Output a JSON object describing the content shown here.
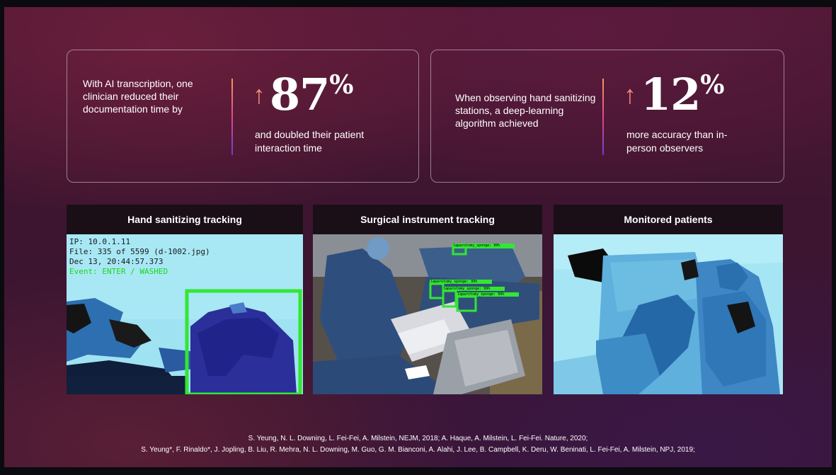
{
  "stats": [
    {
      "description": "With AI transcription, one clinician reduced their documentation time by",
      "value": "87",
      "unit": "%",
      "caption": "and doubled their patient interaction time",
      "arrow": "↑"
    },
    {
      "description": "When observing hand sanitizing stations, a deep-learning algorithm achieved",
      "value": "12",
      "unit": "%",
      "caption": "more accuracy than in-person observers",
      "arrow": "↑"
    }
  ],
  "panels": [
    {
      "title": "Hand sanitizing tracking",
      "overlay": {
        "ip": "IP: 10.0.1.11",
        "file": "File: 335 of 5599 (d-1002.jpg)",
        "date": "Dec 13, 20:44:57.373",
        "event": "Event: ENTER / WASHED"
      }
    },
    {
      "title": "Surgical instrument tracking",
      "labels": [
        "laparotomy_sponge: 99%",
        "laparotomy_sponge: 99%",
        "laparotomy_sponge: 99%",
        "laparotomy_sponge: 99%"
      ]
    },
    {
      "title": "Monitored patients"
    }
  ],
  "citations": {
    "line1": "S. Yeung, N. L. Downing, L. Fei-Fei, A. Milstein, NEJM, 2018; A. Haque, A. Milstein, L. Fei-Fei. Nature, 2020;",
    "line2": "S. Yeung*, F. Rinaldo*, J. Jopling, B. Liu, R. Mehra, N. L. Downing, M. Guo, G. M. Bianconi, A. Alahi, J. Lee, B. Campbell, K. Deru, W. Beninati, L. Fei-Fei, A. Milstein, NPJ, 2019;"
  },
  "colors": {
    "background": "#451631",
    "arrow": "#f28a7a",
    "divider_top": "#f29a5c",
    "divider_bottom": "#6a3fd0",
    "detection_box": "#33e633"
  }
}
